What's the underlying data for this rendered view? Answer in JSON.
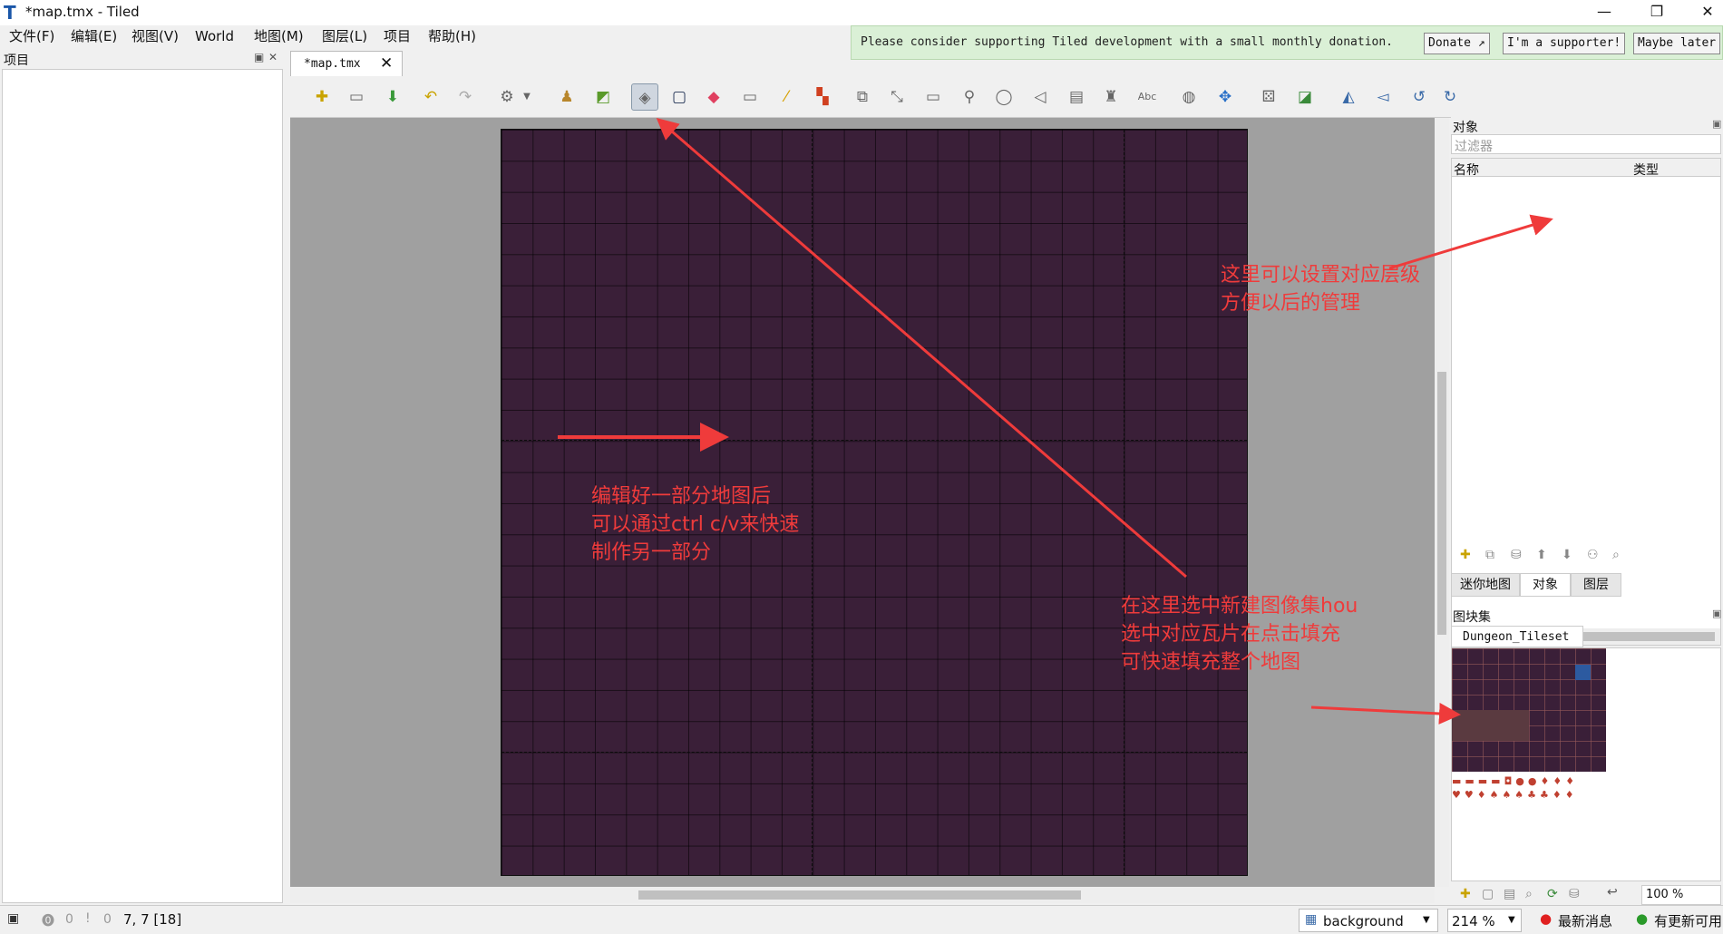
{
  "window": {
    "title": "*map.tmx - Tiled",
    "minimize": "—",
    "restore": "❐",
    "close": "✕"
  },
  "menu": [
    "文件(F)",
    "编辑(E)",
    "视图(V)",
    "World",
    "地图(M)",
    "图层(L)",
    "项目",
    "帮助(H)"
  ],
  "donation": {
    "message": "Please consider supporting Tiled development with a small monthly donation.",
    "donate_label": "Donate ↗",
    "supporter_label": "I'm a supporter!",
    "later_label": "Maybe later"
  },
  "left_panel": {
    "title": "项目"
  },
  "editor": {
    "tab_label": "*map.tmx",
    "tab_close": "✕"
  },
  "toolbar_icons": [
    "new-map-icon",
    "open-icon",
    "save-icon",
    "undo-icon",
    "redo-icon",
    "settings-icon",
    "stamp-brush-icon",
    "terrain-brush-icon",
    "bucket-fill-icon",
    "shape-fill-icon",
    "eraser-icon",
    "rect-select-icon",
    "magic-wand-icon",
    "select-same-tile-icon",
    "select-objects-icon",
    "edit-polygons-icon",
    "insert-rectangle-icon",
    "insert-point-icon",
    "insert-ellipse-icon",
    "insert-polygon-icon",
    "insert-tile-icon",
    "insert-template-icon",
    "insert-text-icon",
    "random-mode-icon",
    "wangset-icon",
    "dice-icon",
    "tile-stamp-icon",
    "flip-horizontal-icon",
    "flip-vertical-icon",
    "rotate-left-icon",
    "rotate-right-icon"
  ],
  "objects_panel": {
    "title": "对象",
    "filter_placeholder": "过滤器",
    "col_name": "名称",
    "col_type": "类型"
  },
  "side_tabs": [
    "迷你地图",
    "对象",
    "图层"
  ],
  "tilesets_panel": {
    "title": "图块集",
    "tab_label": "Dungeon_Tileset",
    "zoom_value": "100 %"
  },
  "status": {
    "errors": "0",
    "warnings": "0",
    "position": "7, 7 [18]",
    "layer": "background",
    "zoom": "214 %",
    "news": "最新消息",
    "update": "有更新可用"
  },
  "annotations": {
    "layers_note": "这里可以设置对应层级\n方便以后的管理",
    "copy_note": "编辑好一部分地图后\n可以通过ctrl c/v来快速\n制作另一部分",
    "fill_note": "在这里选中新建图像集hou\n选中对应瓦片在点击填充\n可快速填充整个地图"
  },
  "colors": {
    "map_bg": "#3a1f38",
    "annotation": "#ef3b3b",
    "donation_bg": "#daf0d6"
  }
}
